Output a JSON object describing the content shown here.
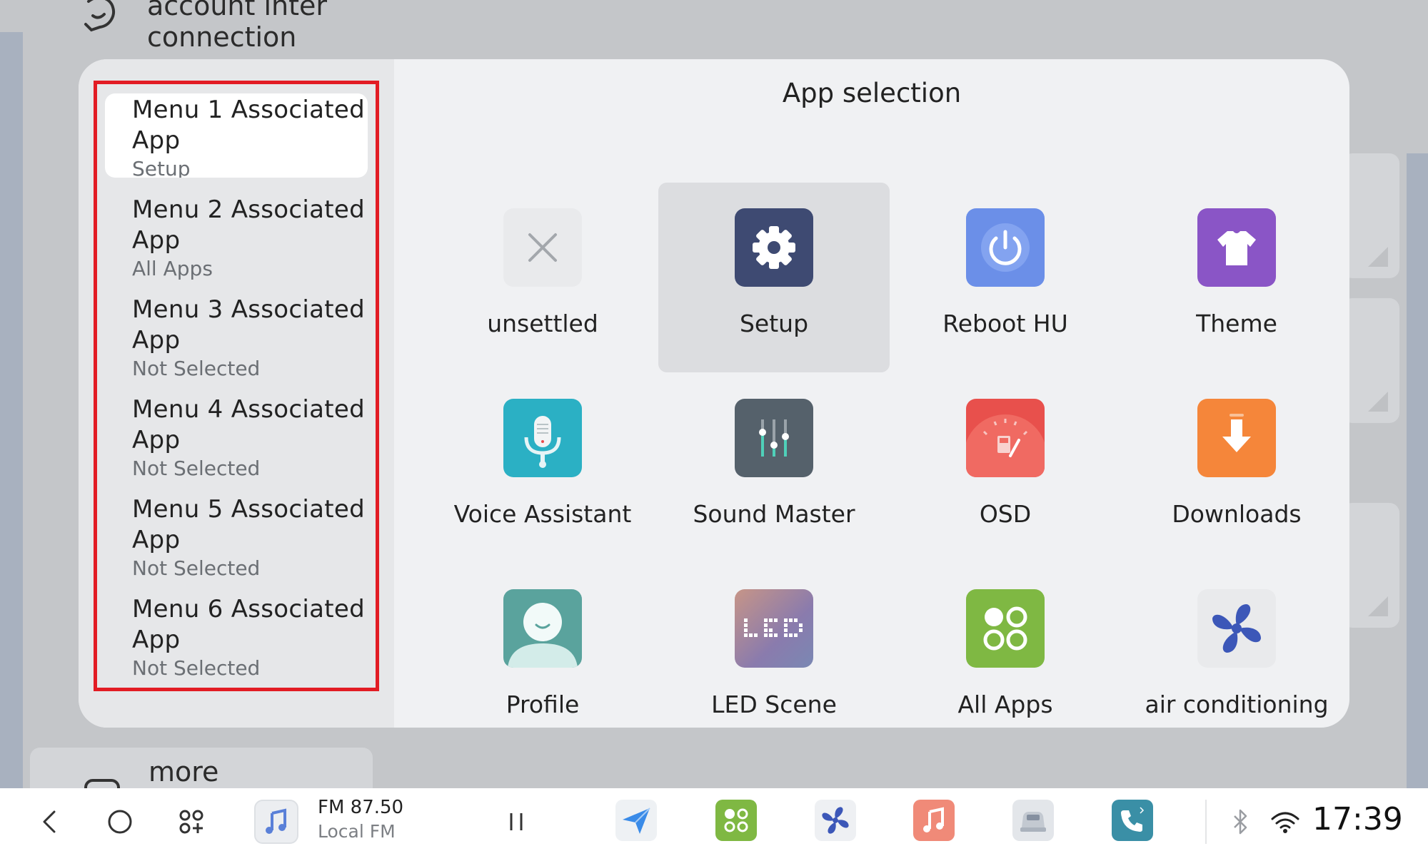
{
  "background": {
    "top_item_label": "account inter connection",
    "bottom_item_label": "more"
  },
  "dialog": {
    "sidebar": {
      "items": [
        {
          "title": "Menu 1 Associated App",
          "value": "Setup",
          "selected": true
        },
        {
          "title": "Menu 2 Associated App",
          "value": "All Apps",
          "selected": false
        },
        {
          "title": "Menu 3 Associated App",
          "value": "Not Selected",
          "selected": false
        },
        {
          "title": "Menu 4 Associated App",
          "value": "Not Selected",
          "selected": false
        },
        {
          "title": "Menu 5 Associated App",
          "value": "Not Selected",
          "selected": false
        },
        {
          "title": "Menu 6 Associated App",
          "value": "Not Selected",
          "selected": false
        }
      ]
    },
    "content": {
      "title": "App selection",
      "apps": [
        {
          "label": "unsettled",
          "icon": "close-icon"
        },
        {
          "label": "Setup",
          "icon": "gear-icon",
          "selected": true
        },
        {
          "label": "Reboot HU",
          "icon": "power-icon"
        },
        {
          "label": "Theme",
          "icon": "tshirt-icon"
        },
        {
          "label": "Voice Assistant",
          "icon": "microphone-icon"
        },
        {
          "label": "Sound Master",
          "icon": "equalizer-icon"
        },
        {
          "label": "OSD",
          "icon": "gauge-icon"
        },
        {
          "label": "Downloads",
          "icon": "download-icon"
        },
        {
          "label": "Profile",
          "icon": "person-icon"
        },
        {
          "label": "LED Scene",
          "icon": "led-icon"
        },
        {
          "label": "All Apps",
          "icon": "apps-grid-icon"
        },
        {
          "label": "air conditioning",
          "icon": "fan-icon"
        }
      ]
    }
  },
  "taskbar": {
    "media": {
      "title": "FM 87.50",
      "subtitle": "Local FM"
    },
    "clock": "17:39"
  },
  "colors": {
    "highlight": "#e21c24",
    "setup_icon_bg": "#3e4a72",
    "reboot_icon_bg": "#6b8fe8",
    "theme_icon_bg": "#8a55c6",
    "voice_icon_bg": "#2bb0c4",
    "sound_icon_bg": "#55616b",
    "osd_icon_bg": "#e8504c",
    "downloads_icon_bg": "#f5863a",
    "profile_icon_bg": "#5aa39d",
    "allapps_icon_bg": "#7fb843"
  }
}
